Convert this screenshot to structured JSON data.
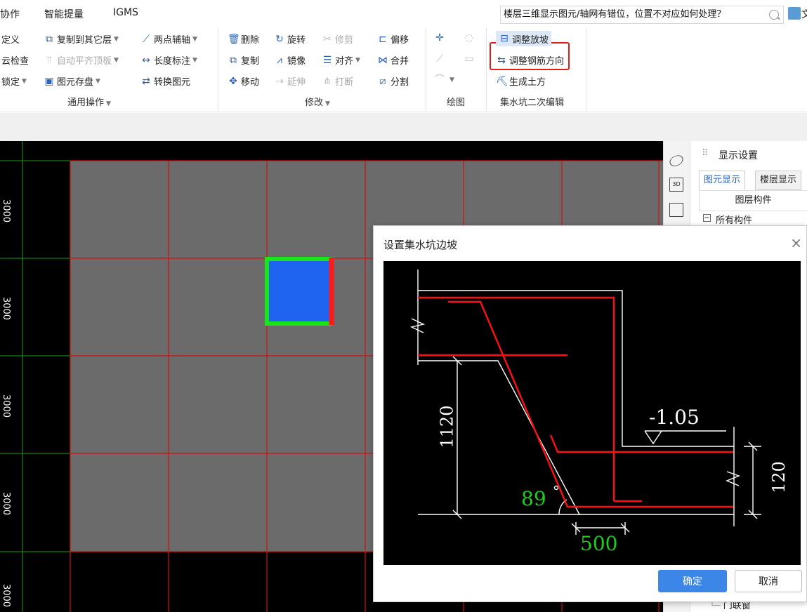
{
  "menu": {
    "items": [
      "协作",
      "智能提量",
      "IGMS"
    ]
  },
  "search": {
    "text": "楼层三维显示图元/轴网有错位，位置不对应如何处理？"
  },
  "user": {
    "text": "文"
  },
  "ribbon": {
    "general": {
      "define": "定义",
      "cloud_check": "云检查",
      "lock": "锁定",
      "copy_to_layer": "复制到其它层",
      "auto_align": "自动平齐顶板",
      "element_store": "图元存盘",
      "two_point_axis": "两点辅轴",
      "length_dim": "长度标注",
      "convert_element": "转换图元",
      "label": "通用操作"
    },
    "modify": {
      "delete": "删除",
      "rotate": "旋转",
      "trim": "修剪",
      "offset": "偏移",
      "copy": "复制",
      "mirror": "镜像",
      "align": "对齐",
      "merge": "合并",
      "move": "移动",
      "extend": "延伸",
      "break": "打断",
      "split": "分割",
      "label": "修改"
    },
    "draw": {
      "label": "绘图"
    },
    "pit_edit": {
      "adjust_slope": "调整放坡",
      "adjust_rebar": "调整钢筋方向",
      "gen_earthwork": "生成土方",
      "label": "集水坑二次编辑"
    }
  },
  "canvas": {
    "axis_labels": [
      "3000",
      "3000",
      "3000",
      "3000",
      "3000"
    ]
  },
  "side_panel": {
    "title": "显示设置",
    "tab_element": "图元显示",
    "tab_floor": "楼层显示",
    "layer_header": "图层构件",
    "all_components": "所有构件",
    "bottom_item": "门联窗"
  },
  "dialog": {
    "title": "设置集水坑边坡",
    "depth": "1120",
    "elevation": "-1.05",
    "thickness": "120",
    "angle": "89",
    "width": "500",
    "ok": "确定",
    "cancel": "取消"
  },
  "colors": {
    "accent": "#3b86e6",
    "highlight": "#e31b1b",
    "grid": "#d21010",
    "slab": "#6b6b6b",
    "pit_fill": "#1e64f0",
    "pit_edge": "#19e619",
    "label_green": "#19d219"
  }
}
